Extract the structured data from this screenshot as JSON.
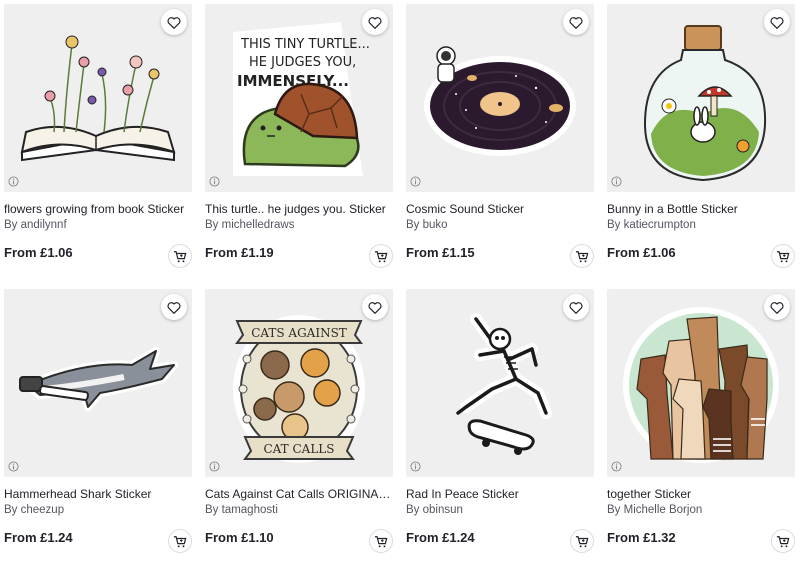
{
  "products": [
    {
      "title": "flowers growing from book Sticker",
      "artist": "By andilynnf",
      "price": "From £1.06",
      "art": "book-flowers"
    },
    {
      "title": "This turtle.. he judges you. Sticker",
      "artist": "By michelledraws",
      "price": "From £1.19",
      "art": "turtle",
      "sticker_text": [
        "THIS TINY TURTLE...",
        "HE JUDGES YOU,",
        "IMMENSELY..."
      ]
    },
    {
      "title": "Cosmic Sound Sticker",
      "artist": "By buko",
      "price": "From £1.15",
      "art": "cosmic-vinyl"
    },
    {
      "title": "Bunny in a Bottle Sticker",
      "artist": "By katiecrumpton",
      "price": "From £1.06",
      "art": "bunny-bottle"
    },
    {
      "title": "Hammerhead Shark Sticker",
      "artist": "By cheezup",
      "price": "From £1.24",
      "art": "hammerhead"
    },
    {
      "title": "Cats Against Cat Calls ORIGINAL (...",
      "artist": "By tamaghosti",
      "price": "From £1.10",
      "art": "cats",
      "sticker_text": [
        "CATS AGAINST",
        "CAT CALLS"
      ]
    },
    {
      "title": "Rad In Peace Sticker",
      "artist": "By obinsun",
      "price": "From £1.24",
      "art": "skeleton"
    },
    {
      "title": "together Sticker",
      "artist": "By Michelle Borjon",
      "price": "From £1.32",
      "art": "fists"
    }
  ]
}
